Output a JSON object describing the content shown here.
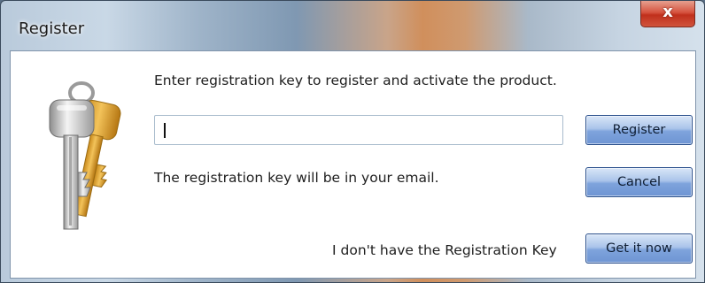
{
  "window": {
    "title": "Register",
    "close_glyph": "x"
  },
  "dialog": {
    "prompt": "Enter registration key to register and activate the product.",
    "key_input": {
      "value": "",
      "placeholder": ""
    },
    "hint": "The registration key will be in your email.",
    "no_key_text": "I don't have the Registration Key",
    "icon": "keys-icon"
  },
  "buttons": {
    "register": "Register",
    "cancel": "Cancel",
    "get_it_now": "Get it now"
  },
  "colors": {
    "button_accent": "#7ea3dc",
    "close_red": "#c0301c"
  }
}
